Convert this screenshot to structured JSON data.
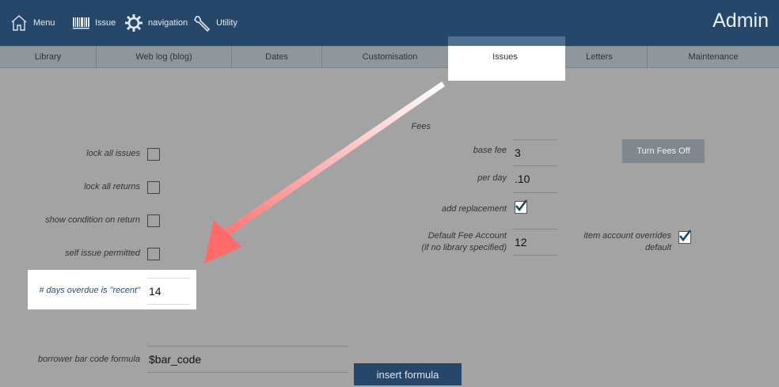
{
  "header": {
    "menu_label": "Menu",
    "issue_label": "Issue",
    "navigation_label": "navigation",
    "utility_label": "Utility",
    "admin_title": "Admin"
  },
  "tabs": [
    "Library",
    "Web log (blog)",
    "Dates",
    "Customisation",
    "Issues",
    "Letters",
    "Maintenance"
  ],
  "issue_settings": {
    "lock_all_issues": "lock all issues",
    "lock_all_returns": "lock all returns",
    "show_condition": "show condition on return",
    "self_issue": "self issue permitted",
    "days_overdue_label": "# days overdue is \"recent\"",
    "days_overdue_value": "14",
    "barcode_label": "borrower bar code formula",
    "barcode_value": "$bar_code",
    "insert_formula": "insert formula"
  },
  "fees": {
    "heading": "Fees",
    "base_fee_label": "base fee",
    "base_fee_value": "3",
    "per_day_label": "per day",
    "per_day_value": ".10",
    "add_replacement_label": "add replacement",
    "add_replacement_checked": true,
    "default_account_label_1": "Default Fee Account",
    "default_account_label_2": "(if no library specified)",
    "default_account_value": "12",
    "item_override_label_1": "item account overrides",
    "item_override_label_2": "default",
    "item_override_checked": true,
    "turn_fees_off": "Turn Fees Off"
  },
  "colors": {
    "header": "#26476a",
    "background": "#a3a3a3",
    "arrow": "#ff6b6b",
    "checkmark": "#1f4a5e"
  }
}
